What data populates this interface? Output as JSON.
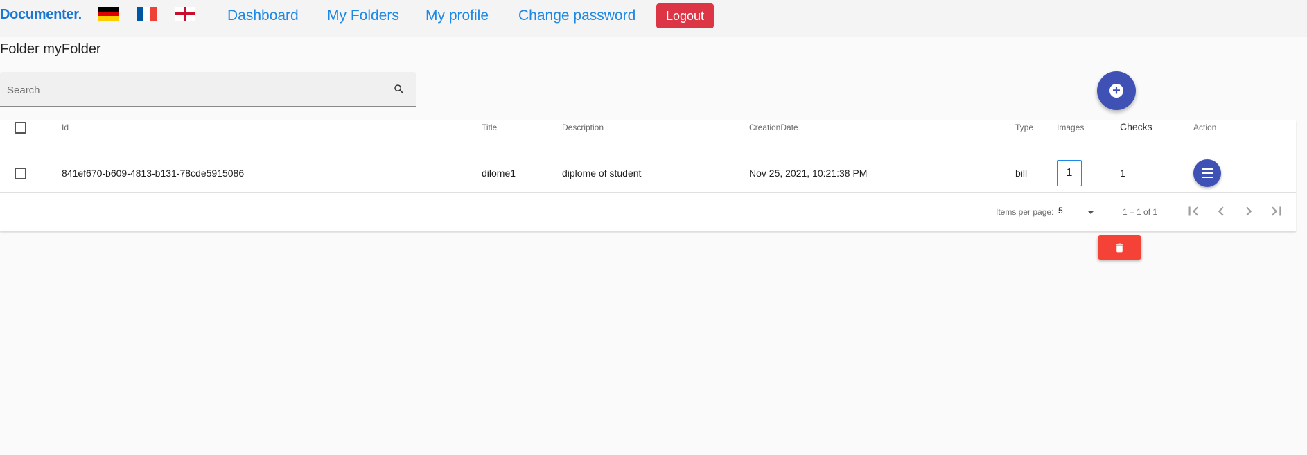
{
  "nav": {
    "brand": "Documenter.",
    "flags": [
      "german-flag",
      "french-flag",
      "english-flag"
    ],
    "links": [
      "Dashboard",
      "My Folders",
      "My profile",
      "Change password"
    ],
    "logout": "Logout"
  },
  "page": {
    "title": "Folder myFolder"
  },
  "search": {
    "placeholder": "Search",
    "icon": "search-icon"
  },
  "table": {
    "headers": {
      "id": "Id",
      "title": "Title",
      "description": "Description",
      "creation_date": "CreationDate",
      "type": "Type",
      "images": "Images",
      "checks": "Checks",
      "action": "Action"
    },
    "rows": [
      {
        "id": "841ef670-b609-4813-b131-78cde5915086",
        "title": "dilome1",
        "description": "diplome of student",
        "creation_date": "Nov 25, 2021, 10:21:38 PM",
        "type": "bill",
        "images": "1",
        "checks": "1"
      }
    ]
  },
  "paginator": {
    "items_per_page_label": "Items per page:",
    "page_size": "5",
    "range": "1 – 1 of 1"
  },
  "colors": {
    "brand": "#1976d2",
    "link": "#1e88e5",
    "logout": "#dc3545",
    "fab": "#3f51b5",
    "delete": "#f44336"
  }
}
